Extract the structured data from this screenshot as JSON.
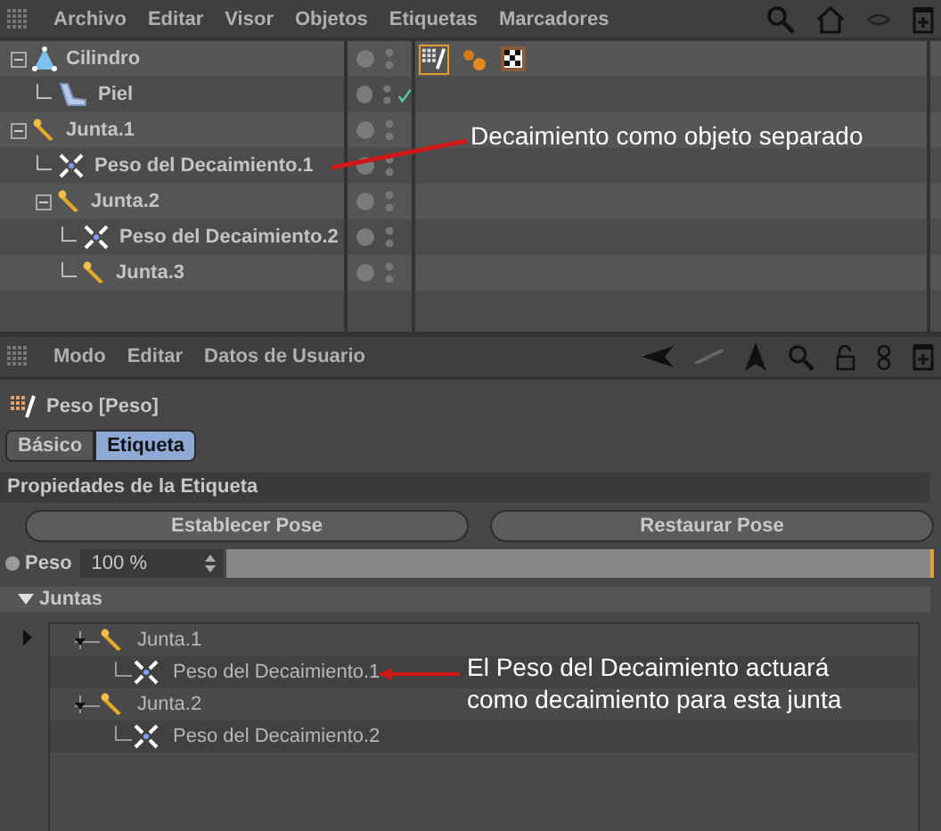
{
  "object_manager": {
    "menu": [
      "Archivo",
      "Editar",
      "Visor",
      "Objetos",
      "Etiquetas",
      "Marcadores"
    ],
    "objects": [
      {
        "name": "Cilindro",
        "kind": "cylinder",
        "expanded": true,
        "tags": [
          {
            "kind": "weight",
            "selected": true
          },
          {
            "kind": "joints",
            "selected": false
          },
          {
            "kind": "texture",
            "selected": false
          }
        ],
        "children": [
          {
            "name": "Piel",
            "kind": "skin",
            "enabled": true
          }
        ]
      },
      {
        "name": "Junta.1",
        "kind": "joint",
        "expanded": true,
        "children": [
          {
            "name": "Peso del Decaimiento.1",
            "kind": "falloff"
          },
          {
            "name": "Junta.2",
            "kind": "joint",
            "expanded": true,
            "children": [
              {
                "name": "Peso del Decaimiento.2",
                "kind": "falloff"
              },
              {
                "name": "Junta.3",
                "kind": "joint"
              }
            ]
          }
        ]
      }
    ],
    "annotation": "Decaimiento como objeto separado"
  },
  "attribute_manager": {
    "menu": [
      "Modo",
      "Editar",
      "Datos de Usuario"
    ],
    "title": "Peso [Peso]",
    "tabs": [
      {
        "label": "Básico",
        "selected": false
      },
      {
        "label": "Etiqueta",
        "selected": true
      }
    ],
    "section": "Propiedades de la Etiqueta",
    "buttons": [
      "Establecer Pose",
      "Restaurar Pose"
    ],
    "weight": {
      "label": "Peso",
      "value": "100 %",
      "level": 1.0
    },
    "joints_header": "Juntas",
    "joints": [
      {
        "name": "Junta.1",
        "kind": "joint",
        "children": [
          {
            "name": "Peso del Decaimiento.1",
            "kind": "falloff"
          }
        ]
      },
      {
        "name": "Junta.2",
        "kind": "joint",
        "children": [
          {
            "name": "Peso del Decaimiento.2",
            "kind": "falloff"
          }
        ]
      }
    ],
    "annotation": "El Peso del Decaimiento actuará como decaimiento para esta junta"
  }
}
